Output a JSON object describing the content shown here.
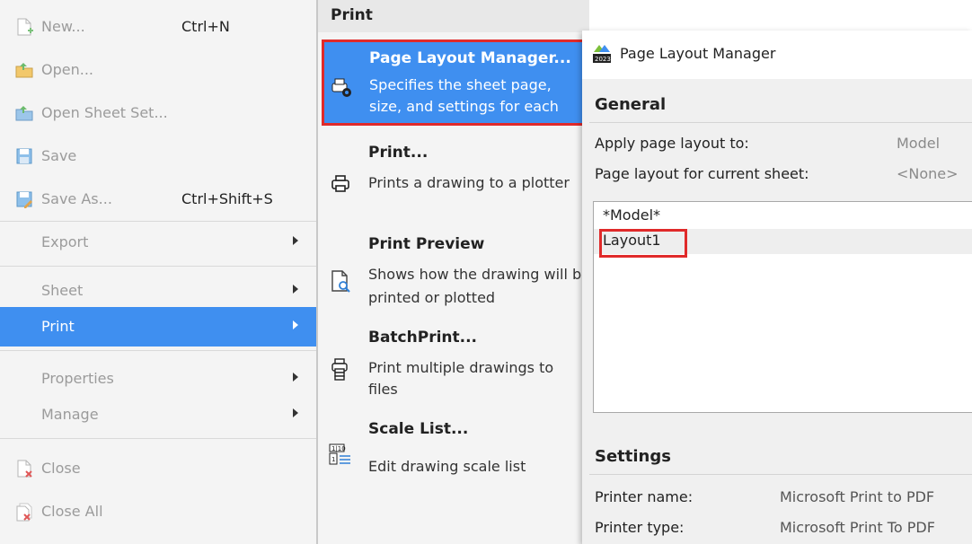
{
  "file_menu": {
    "items": [
      {
        "label": "New...",
        "shortcut": "Ctrl+N",
        "icon": "new-document-icon"
      },
      {
        "label": "Open...",
        "shortcut": "",
        "icon": "open-folder-icon"
      },
      {
        "label": "Open Sheet Set...",
        "shortcut": "",
        "icon": "open-sheet-set-icon"
      },
      {
        "label": "Save",
        "shortcut": "",
        "icon": "save-icon"
      },
      {
        "label": "Save As...",
        "shortcut": "Ctrl+Shift+S",
        "icon": "save-as-icon"
      },
      {
        "label": "Export",
        "shortcut": "",
        "icon": ""
      },
      {
        "label": "Sheet",
        "shortcut": "",
        "icon": ""
      },
      {
        "label": "Print",
        "shortcut": "",
        "icon": ""
      },
      {
        "label": "Properties",
        "shortcut": "",
        "icon": ""
      },
      {
        "label": "Manage",
        "shortcut": "",
        "icon": ""
      },
      {
        "label": "Close",
        "shortcut": "",
        "icon": "close-document-icon"
      },
      {
        "label": "Close All",
        "shortcut": "",
        "icon": "close-all-icon"
      }
    ],
    "selected": "Print",
    "accent_color": "#3f8ff0"
  },
  "submenu": {
    "header": "Print",
    "items": [
      {
        "title": "Page Layout Manager...",
        "desc1": "Specifies the sheet page,",
        "desc2": "size, and settings for each",
        "icon": "page-layout-manager-icon"
      },
      {
        "title": "Print...",
        "desc1": "Prints a drawing to a plotter",
        "desc2": "",
        "icon": "printer-icon"
      },
      {
        "title": "Print Preview",
        "desc1": "Shows how the drawing will be",
        "desc2": "printed or plotted",
        "icon": "print-preview-icon"
      },
      {
        "title": "BatchPrint...",
        "desc1": "Print multiple drawings to",
        "desc2": "files",
        "icon": "batch-print-icon"
      },
      {
        "title": "Scale List...",
        "desc1": "Edit drawing scale list",
        "desc2": "",
        "icon": "scale-list-icon"
      }
    ]
  },
  "dialog": {
    "title": "Page Layout Manager",
    "general": {
      "title": "General",
      "apply_label": "Apply page layout to:",
      "apply_value": "Model",
      "current_label": "Page layout for current sheet:",
      "current_value": "<None>"
    },
    "layouts": [
      "*Model*",
      "Layout1"
    ],
    "selected_layout": "Layout1",
    "settings": {
      "title": "Settings",
      "printer_name_label": "Printer name:",
      "printer_name_value": "Microsoft Print to PDF",
      "printer_type_label": "Printer type:",
      "printer_type_value": "Microsoft Print To PDF"
    }
  }
}
